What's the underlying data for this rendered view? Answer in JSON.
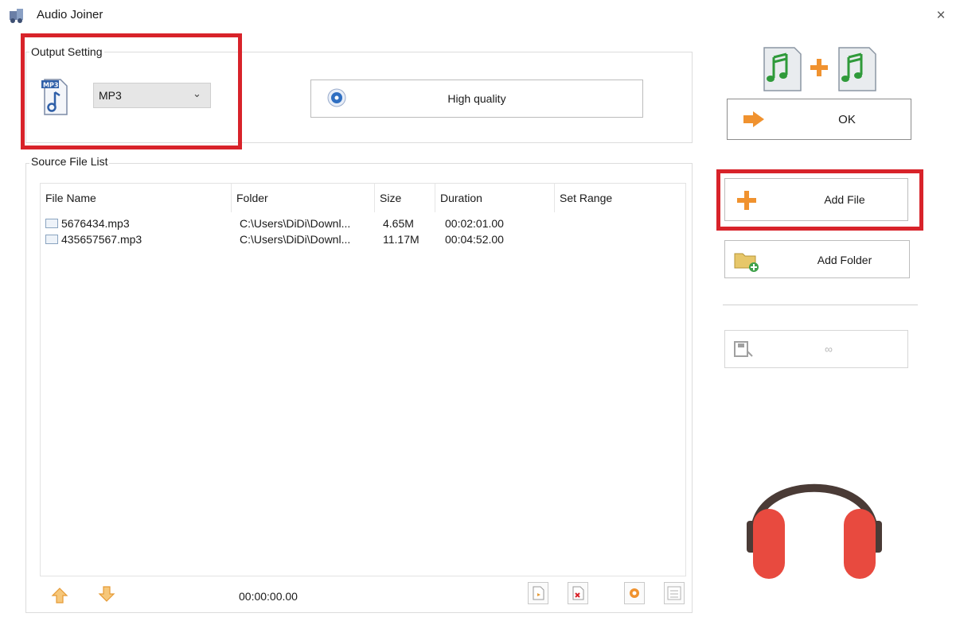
{
  "window": {
    "title": "Audio Joiner",
    "close_glyph": "×"
  },
  "output_setting": {
    "legend": "Output Setting",
    "format_value": "MP3",
    "format_icon_label": "MP3",
    "quality_label": "High quality"
  },
  "actions": {
    "ok_label": "OK",
    "add_file_label": "Add File",
    "add_folder_label": "Add Folder"
  },
  "source_list": {
    "legend": "Source File List",
    "columns": [
      "File Name",
      "Folder",
      "Size",
      "Duration",
      "Set Range"
    ],
    "rows": [
      {
        "file_name": "5676434.mp3",
        "folder": "C:\\Users\\DiDi\\Downl...",
        "size": "4.65M",
        "duration": "00:02:01.00",
        "range": ""
      },
      {
        "file_name": "435657567.mp3",
        "folder": "C:\\Users\\DiDi\\Downl...",
        "size": "11.17M",
        "duration": "00:04:52.00",
        "range": ""
      }
    ],
    "time_readout": "00:00:00.00"
  },
  "icons": {
    "app": "music-app-icon",
    "close": "close-icon",
    "mp3_file": "mp3-file-icon",
    "quality": "disc-icon",
    "join": "music-join-icon",
    "ok": "arrow-right-icon",
    "add_file": "plus-icon",
    "add_folder": "folder-add-icon",
    "range_save": "save-range-icon",
    "move_up": "arrow-up-icon",
    "move_down": "arrow-down-icon",
    "headphones": "headphones-icon"
  },
  "colors": {
    "highlight_red": "#d8232a",
    "accent_orange": "#f0922f",
    "headphone_red": "#e84a3f",
    "headband": "#4a3b36"
  }
}
